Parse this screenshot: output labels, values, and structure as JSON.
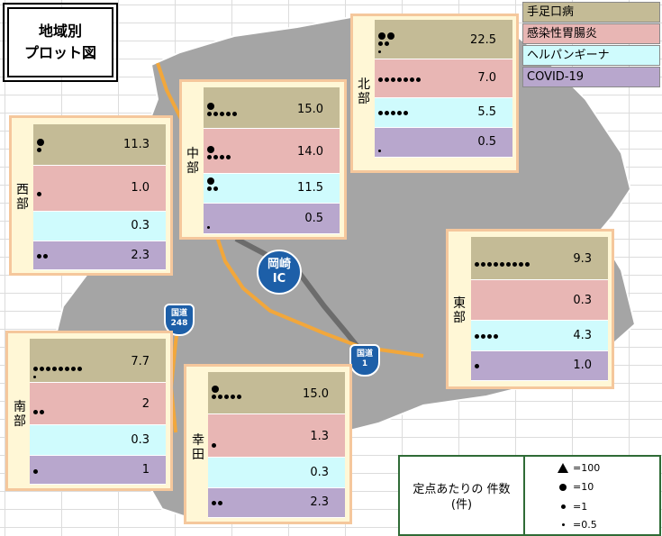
{
  "title": {
    "line1": "地域別",
    "line2": "プロット図"
  },
  "legend": [
    {
      "label": "手足口病",
      "color": "#c4bb96"
    },
    {
      "label": "感染性胃腸炎",
      "color": "#e8b6b4"
    },
    {
      "label": "ヘルパンギーナ",
      "color": "#cffbfd"
    },
    {
      "label": "COVID-19",
      "color": "#b8a7cd"
    }
  ],
  "regions": {
    "north": {
      "name_c1": "北",
      "name_c2": "部",
      "values": [
        "22.5",
        "7.0",
        "5.5",
        "0.5"
      ]
    },
    "west": {
      "name_c1": "西",
      "name_c2": "部",
      "values": [
        "11.3",
        "1.0",
        "0.3",
        "2.3"
      ]
    },
    "central": {
      "name_c1": "中",
      "name_c2": "部",
      "values": [
        "15.0",
        "14.0",
        "11.5",
        "0.5"
      ]
    },
    "east": {
      "name_c1": "東",
      "name_c2": "部",
      "values": [
        "9.3",
        "0.3",
        "4.3",
        "1.0"
      ]
    },
    "south": {
      "name_c1": "南",
      "name_c2": "部",
      "values": [
        "7.7",
        "2",
        "0.3",
        "1"
      ]
    },
    "kota": {
      "name_c1": "幸",
      "name_c2": "田",
      "values": [
        "15.0",
        "1.3",
        "0.3",
        "2.3"
      ]
    }
  },
  "signs": {
    "ic_line1": "岡崎",
    "ic_line2": "IC",
    "r248_top": "国道",
    "r248_num": "248",
    "r1_top": "国道",
    "r1_num": "1"
  },
  "key": {
    "title_line1": "定点あたりの 件数",
    "title_line2": "(件)",
    "items": [
      {
        "symbol": "triangle-icon",
        "label": "=100"
      },
      {
        "symbol": "large-dot-icon",
        "label": "=10"
      },
      {
        "symbol": "medium-dot-icon",
        "label": "=1"
      },
      {
        "symbol": "small-dot-icon",
        "label": "=0.5"
      }
    ]
  }
}
